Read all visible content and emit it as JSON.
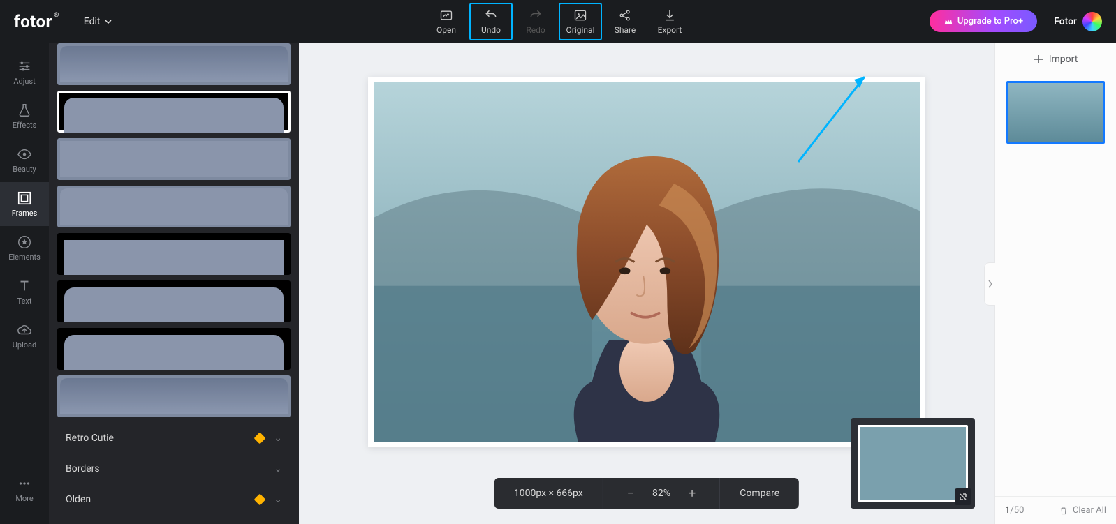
{
  "brand": {
    "name": "fotor",
    "tm": "®"
  },
  "header": {
    "edit": "Edit",
    "buttons": {
      "open": "Open",
      "undo": "Undo",
      "redo": "Redo",
      "original": "Original",
      "share": "Share",
      "export": "Export"
    },
    "upgrade": "Upgrade to Pro+",
    "user": "Fotor"
  },
  "nav": {
    "items": [
      {
        "key": "adjust",
        "label": "Adjust"
      },
      {
        "key": "effects",
        "label": "Effects"
      },
      {
        "key": "beauty",
        "label": "Beauty"
      },
      {
        "key": "frames",
        "label": "Frames"
      },
      {
        "key": "elements",
        "label": "Elements"
      },
      {
        "key": "text",
        "label": "Text"
      },
      {
        "key": "upload",
        "label": "Upload"
      }
    ],
    "more": "More"
  },
  "panel": {
    "categories": [
      {
        "label": "Retro Cutie",
        "premium": true
      },
      {
        "label": "Borders",
        "premium": false
      },
      {
        "label": "Olden",
        "premium": true
      }
    ]
  },
  "status": {
    "dimensions": "1000px × 666px",
    "zoom": "82%",
    "compare": "Compare"
  },
  "rail": {
    "import": "Import",
    "count": {
      "current": "1",
      "sep": "/",
      "total": "50"
    },
    "clear": "Clear All"
  }
}
